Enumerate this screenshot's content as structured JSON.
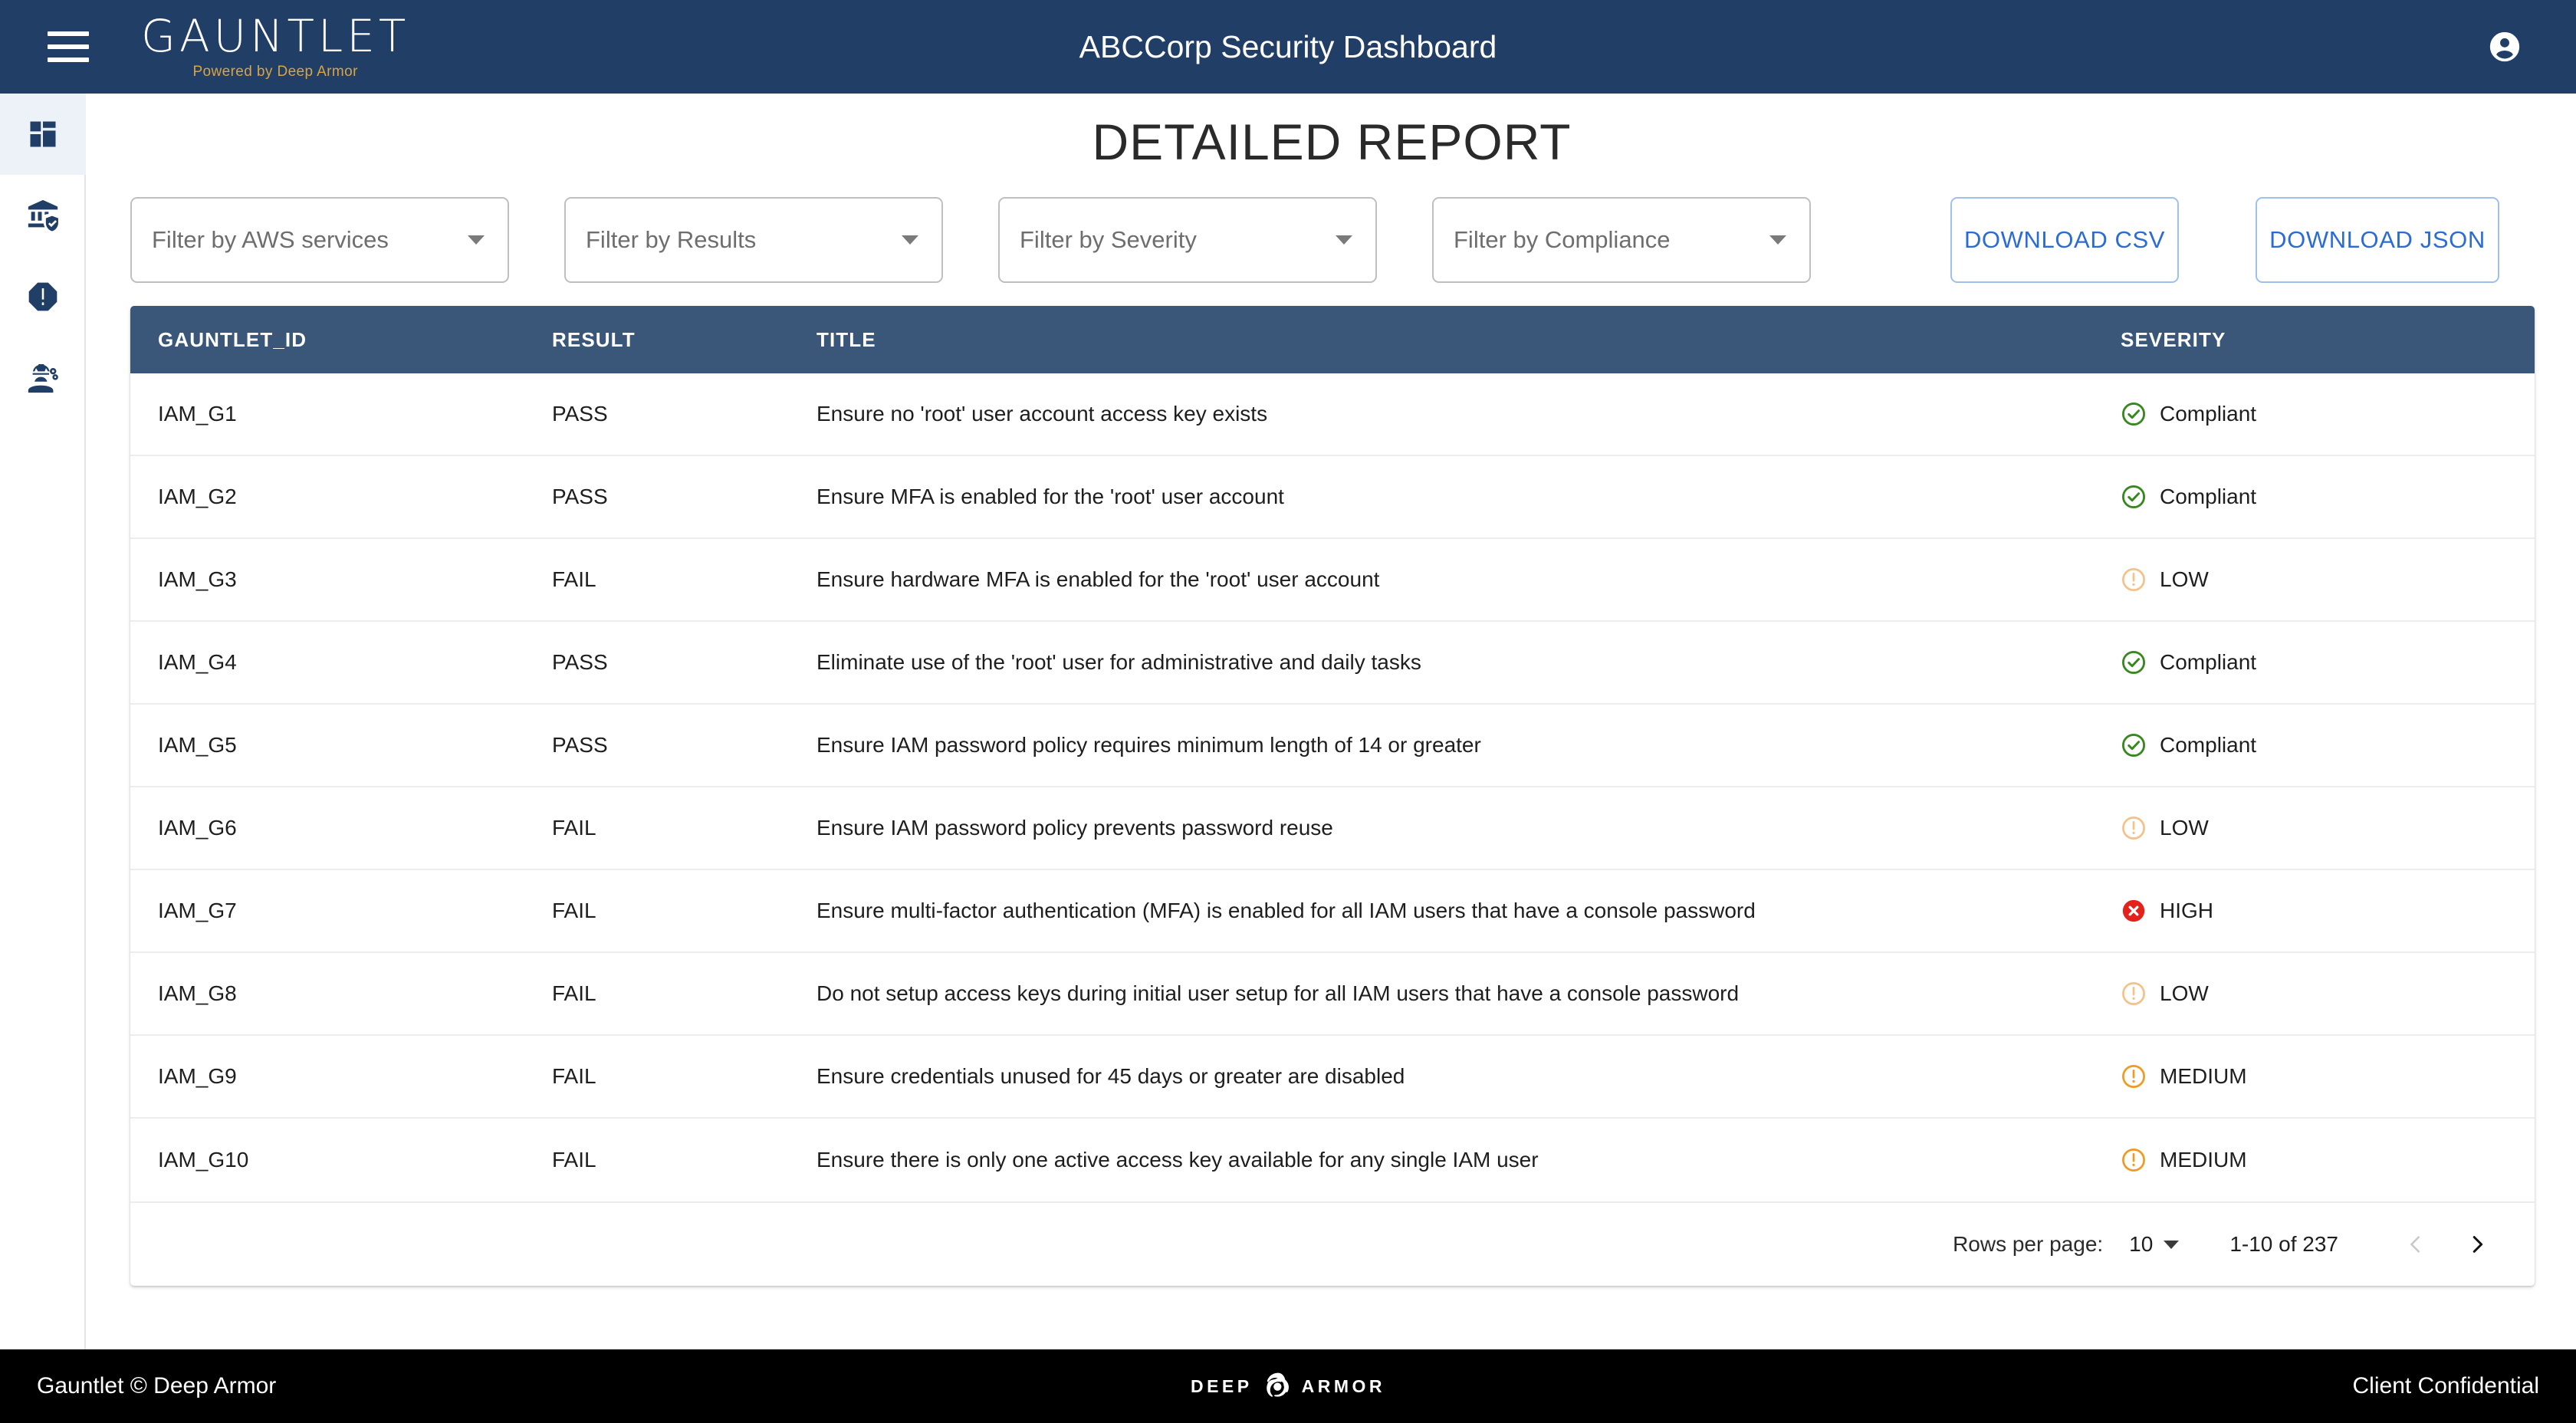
{
  "topbar": {
    "menu_icon": "hamburger-menu-icon",
    "logo_word": "GAUNTLET",
    "logo_tagline": "Powered by Deep Armor",
    "title": "ABCCorp Security Dashboard",
    "avatar_icon": "account-circle-icon",
    "bg_color": "#213E66",
    "accent_gold": "#D9A441"
  },
  "sidebar": {
    "items": [
      {
        "name": "dashboard",
        "icon": "dashboard-grid-icon",
        "active": true
      },
      {
        "name": "compliance",
        "icon": "account-balance-shield-icon",
        "active": false
      },
      {
        "name": "alerts",
        "icon": "warning-octagon-icon",
        "active": false
      },
      {
        "name": "engineering",
        "icon": "engineering-worker-icon",
        "active": false
      }
    ],
    "active_bg": "#EDF1F8"
  },
  "page": {
    "title": "DETAILED REPORT"
  },
  "filters": [
    {
      "name": "aws-services",
      "label": "Filter by AWS services"
    },
    {
      "name": "results",
      "label": "Filter by Results"
    },
    {
      "name": "severity",
      "label": "Filter by Severity"
    },
    {
      "name": "compliance",
      "label": "Filter by Compliance"
    }
  ],
  "actions": {
    "download_csv": "DOWNLOAD CSV",
    "download_json": "DOWNLOAD JSON",
    "link_color": "#2B6CD4"
  },
  "table": {
    "header_bg": "#3A5679",
    "columns": [
      "GAUNTLET_ID",
      "RESULT",
      "TITLE",
      "SEVERITY"
    ],
    "rows": [
      {
        "id": "IAM_G1",
        "result": "PASS",
        "title": "Ensure no 'root' user account access key exists",
        "severity": "Compliant",
        "sev_kind": "compliant"
      },
      {
        "id": "IAM_G2",
        "result": "PASS",
        "title": "Ensure MFA is enabled for the 'root' user account",
        "severity": "Compliant",
        "sev_kind": "compliant"
      },
      {
        "id": "IAM_G3",
        "result": "FAIL",
        "title": "Ensure hardware MFA is enabled for the 'root' user account",
        "severity": "LOW",
        "sev_kind": "low"
      },
      {
        "id": "IAM_G4",
        "result": "PASS",
        "title": "Eliminate use of the 'root' user for administrative and daily tasks",
        "severity": "Compliant",
        "sev_kind": "compliant"
      },
      {
        "id": "IAM_G5",
        "result": "PASS",
        "title": "Ensure IAM password policy requires minimum length of 14 or greater",
        "severity": "Compliant",
        "sev_kind": "compliant"
      },
      {
        "id": "IAM_G6",
        "result": "FAIL",
        "title": "Ensure IAM password policy prevents password reuse",
        "severity": "LOW",
        "sev_kind": "low"
      },
      {
        "id": "IAM_G7",
        "result": "FAIL",
        "title": "Ensure multi-factor authentication (MFA) is enabled for all IAM users that have a console password",
        "severity": "HIGH",
        "sev_kind": "high"
      },
      {
        "id": "IAM_G8",
        "result": "FAIL",
        "title": "Do not setup access keys during initial user setup for all IAM users that have a console password",
        "severity": "LOW",
        "sev_kind": "low"
      },
      {
        "id": "IAM_G9",
        "result": "FAIL",
        "title": "Ensure credentials unused for 45 days or greater are disabled",
        "severity": "MEDIUM",
        "sev_kind": "medium"
      },
      {
        "id": "IAM_G10",
        "result": "FAIL",
        "title": "Ensure there is only one active access key available for any single IAM user",
        "severity": "MEDIUM",
        "sev_kind": "medium"
      }
    ],
    "severity_colors": {
      "compliant": "#37881F",
      "low": "#F5C189",
      "medium": "#EF9A22",
      "high": "#E5211C"
    }
  },
  "pagination": {
    "rows_per_page_label": "Rows per page:",
    "rows_per_page_value": "10",
    "range_label": "1-10 of 237",
    "prev_icon": "chevron-left-icon",
    "next_icon": "chevron-right-icon",
    "prev_enabled": false,
    "next_enabled": true
  },
  "footer": {
    "left": "Gauntlet © Deep Armor",
    "logo_left": "DEEP",
    "logo_icon": "nautilus-shell-icon",
    "logo_right": "ARMOR",
    "right": "Client Confidential"
  }
}
